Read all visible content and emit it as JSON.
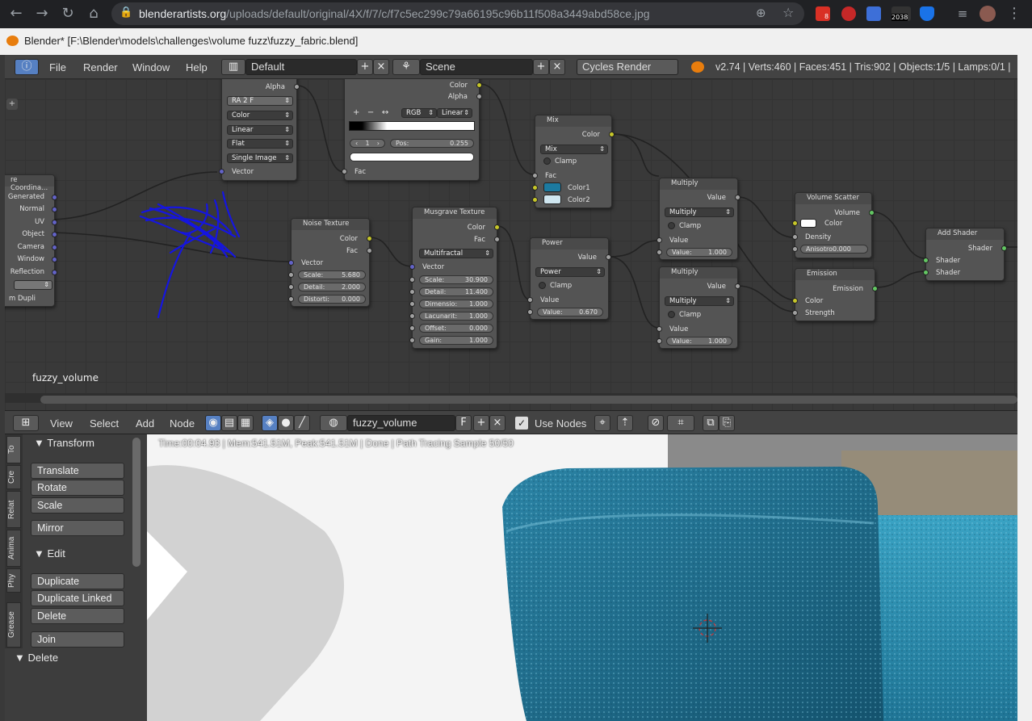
{
  "browser": {
    "url_host": "blenderartists.org",
    "url_path": "/uploads/default/original/4X/f/7/c/f7c5ec299c79a66195c96b11f508a3449abd58ce.jpg",
    "gmail_badge": "8",
    "ext_count": "2038"
  },
  "window": {
    "title": "Blender* [F:\\Blender\\models\\challenges\\volume fuzz\\fuzzy_fabric.blend]"
  },
  "topbar": {
    "menus": [
      "File",
      "Render",
      "Window",
      "Help"
    ],
    "layout": "Default",
    "scene": "Scene",
    "engine": "Cycles Render",
    "stats": "v2.74 | Verts:460 | Faces:451 | Tris:902 | Objects:1/5 | Lamps:0/1 |"
  },
  "nodes": {
    "texcoord": {
      "title": "re Coordina...",
      "outputs": [
        "Generated",
        "Normal",
        "UV",
        "Object",
        "Camera",
        "Window",
        "Reflection"
      ],
      "from_dupli": "m Dupli"
    },
    "image": {
      "alpha": "Alpha",
      "btns": "RA  2  F",
      "color": "Color",
      "interp": "Linear",
      "proj": "Flat",
      "source": "Single Image",
      "vector": "Vector"
    },
    "ramp": {
      "out_color": "Color",
      "out_alpha": "Alpha",
      "mode": "RGB",
      "interp": "Linear",
      "index": "1",
      "pos_label": "Pos:",
      "pos": "0.255",
      "fac": "Fac"
    },
    "mix": {
      "title": "Mix",
      "out": "Color",
      "blend": "Mix",
      "clamp": "Clamp",
      "fac": "Fac",
      "c1": "Color1",
      "c2": "Color2"
    },
    "noise": {
      "title": "Noise Texture",
      "out_color": "Color",
      "out_fac": "Fac",
      "vector": "Vector",
      "scale_l": "Scale:",
      "scale": "5.680",
      "detail_l": "Detail:",
      "detail": "2.000",
      "dist_l": "Distorti:",
      "dist": "0.000"
    },
    "musgrave": {
      "title": "Musgrave Texture",
      "out_color": "Color",
      "out_fac": "Fac",
      "type": "Multifractal",
      "vector": "Vector",
      "params": [
        [
          "Scale:",
          "30.900"
        ],
        [
          "Detail:",
          "11.400"
        ],
        [
          "Dimensio:",
          "1.000"
        ],
        [
          "Lacunarit:",
          "1.000"
        ],
        [
          "Offset:",
          "0.000"
        ],
        [
          "Gain:",
          "1.000"
        ]
      ]
    },
    "power": {
      "title": "Power",
      "out": "Value",
      "op": "Power",
      "clamp": "Clamp",
      "value": "Value",
      "v_l": "Value:",
      "v": "0.670"
    },
    "mult1": {
      "title": "Multiply",
      "out": "Value",
      "op": "Multiply",
      "clamp": "Clamp",
      "value": "Value",
      "v_l": "Value:",
      "v": "1.000"
    },
    "mult2": {
      "title": "Multiply",
      "out": "Value",
      "op": "Multiply",
      "clamp": "Clamp",
      "value": "Value",
      "v_l": "Value:",
      "v": "1.000"
    },
    "scatter": {
      "title": "Volume Scatter",
      "out": "Volume",
      "color": "Color",
      "density": "Density",
      "aniso": "Anisotro0.000"
    },
    "emission": {
      "title": "Emission",
      "out": "Emission",
      "color": "Color",
      "strength": "Strength"
    },
    "addshader": {
      "title": "Add Shader",
      "out": "Shader",
      "in1": "Shader",
      "in2": "Shader"
    },
    "material_label": "fuzzy_volume"
  },
  "nodeheader": {
    "menus": [
      "View",
      "Select",
      "Add",
      "Node"
    ],
    "material": "fuzzy_volume",
    "fake_user": "F",
    "use_nodes": "Use Nodes"
  },
  "toolshelf": {
    "tabs": [
      "To",
      "Cre",
      "Relat",
      "Anima",
      "Phy",
      "Grease"
    ],
    "transform_title": "Transform",
    "transform": [
      "Translate",
      "Rotate",
      "Scale"
    ],
    "mirror": "Mirror",
    "edit_title": "Edit",
    "edit": [
      "Duplicate",
      "Duplicate Linked",
      "Delete"
    ],
    "join": "Join",
    "delete_title": "Delete"
  },
  "viewport": {
    "status": "Time:00:04.93 | Mem:541.51M, Peak:541.51M | Done | Path Tracing Sample 50/50"
  },
  "colors": {
    "accent": "#5680c2",
    "fabric": "#3a8fa8",
    "scribble": "#1515e0"
  }
}
